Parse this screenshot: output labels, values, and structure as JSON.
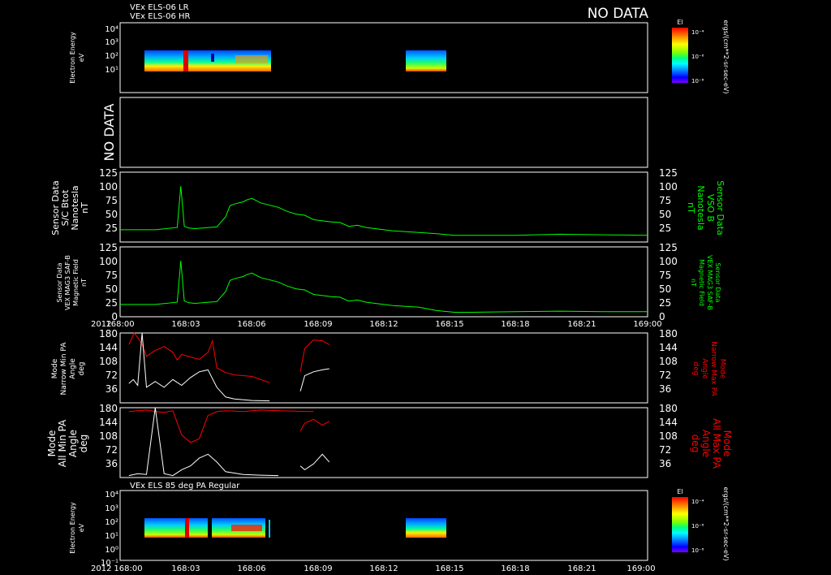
{
  "header": {
    "line1": "VEx ELS-06 LR",
    "line2": "VEx ELS-06 HR",
    "no_data": "NO DATA"
  },
  "time_axis": {
    "year": "2012",
    "ticks": [
      "168:00",
      "168:03",
      "168:06",
      "168:09",
      "168:12",
      "168:15",
      "168:18",
      "168:21",
      "169:00"
    ]
  },
  "colorbar": {
    "label": "El",
    "unit": "ergs/(cm**2-sr-sec-eV)",
    "top_tick": "10⁻⁴",
    "mid_tick": "10⁻⁶",
    "bottom_tick": "10⁻⁸",
    "colors": [
      "#ff0000",
      "#ff8000",
      "#ffff00",
      "#80ff00",
      "#00ff80",
      "#00ffff",
      "#0080ff",
      "#0000ff",
      "#8000ff"
    ]
  },
  "panels": {
    "els_spectrogram": {
      "ylabel": "Electron Energy",
      "yunit": "eV",
      "yticks": [
        "10⁴",
        "10³",
        "10²",
        "10¹"
      ]
    },
    "no_data_panel": {
      "text": "NO DATA"
    },
    "sc_btot": {
      "ylabel_left": [
        "Sensor Data",
        "S/C Btot",
        "Nanotesla",
        "nT"
      ],
      "ylabel_right": [
        "Sensor Data",
        "VSO B",
        "Nanotesla",
        "nT"
      ],
      "yticks": [
        "125",
        "100",
        "75",
        "50",
        "25"
      ]
    },
    "mag_field": {
      "ylabel_left": [
        "Sensor Data",
        "VEX MAG3 SAF-B",
        "Magnetic Field",
        "nT"
      ],
      "ylabel_right": [
        "Sensor Data",
        "VEX MAG3 SAF-B",
        "Magnetic Field",
        "nT"
      ],
      "yticks": [
        "125",
        "100",
        "75",
        "50",
        "25",
        "0"
      ]
    },
    "narrow_pa": {
      "ylabel_left": [
        "Mode",
        "Narrow Min PA",
        "Angle",
        "deg"
      ],
      "ylabel_right": [
        "Mode",
        "Narrow Max PA",
        "Angle",
        "deg"
      ],
      "yticks": [
        "180",
        "144",
        "108",
        "72",
        "36"
      ]
    },
    "all_pa": {
      "ylabel_left": [
        "Mode",
        "All Min PA",
        "Angle",
        "deg"
      ],
      "ylabel_right": [
        "Mode",
        "All Max PA",
        "Angle",
        "deg"
      ],
      "yticks": [
        "180",
        "144",
        "108",
        "72",
        "36"
      ]
    },
    "pa85": {
      "title": "VEx ELS 85 deg PA Regular",
      "ylabel": "Electron Energy",
      "yunit": "eV",
      "yticks": [
        "10⁴",
        "10³",
        "10²",
        "10¹",
        "10⁰",
        "10⁻¹"
      ]
    }
  },
  "chart_data": [
    {
      "type": "heatmap",
      "name": "ELS-06 spectrogram",
      "x_range_min": [
        0,
        60
      ],
      "ylabel": "Electron Energy (eV)",
      "y_log_range": [
        1,
        10000
      ],
      "data_intervals_min": [
        [
          0.9,
          9.5
        ],
        [
          20.5,
          23.5
        ]
      ],
      "peak_bands_min": [
        [
          2.7,
          3.0
        ]
      ]
    },
    {
      "type": "line",
      "name": "S/C Btot",
      "ylim": [
        0,
        125
      ],
      "color": "#00ff00",
      "x_min": [
        0,
        4,
        6.5,
        6.9,
        7.3,
        7.8,
        8.5,
        11,
        12,
        12.5,
        13,
        14,
        14.5,
        15,
        16,
        18,
        19,
        20,
        21,
        22,
        23,
        24,
        25,
        26,
        27,
        28,
        29,
        30,
        31,
        32,
        33,
        34,
        36,
        38,
        40,
        45,
        50,
        55,
        60
      ],
      "y": [
        22,
        22,
        26,
        100,
        28,
        25,
        24,
        27,
        45,
        65,
        68,
        72,
        76,
        78,
        70,
        62,
        55,
        50,
        48,
        40,
        38,
        36,
        35,
        28,
        30,
        26,
        24,
        22,
        20,
        19,
        18,
        17,
        15,
        12,
        12,
        12,
        14,
        13,
        12
      ]
    },
    {
      "type": "line",
      "name": "Magnetic Field",
      "ylim": [
        0,
        125
      ],
      "color": "#00ff00",
      "x_min": [
        0,
        4,
        6.5,
        6.9,
        7.3,
        7.8,
        8.5,
        11,
        12,
        12.5,
        13,
        14,
        14.5,
        15,
        16,
        18,
        19,
        20,
        21,
        22,
        23,
        24,
        25,
        26,
        27,
        28,
        29,
        30,
        31,
        32,
        33,
        34,
        36,
        38,
        40,
        45,
        50,
        55,
        60
      ],
      "y": [
        22,
        22,
        26,
        100,
        28,
        25,
        24,
        27,
        45,
        65,
        68,
        72,
        76,
        78,
        70,
        62,
        55,
        50,
        48,
        40,
        38,
        36,
        35,
        28,
        30,
        26,
        24,
        22,
        20,
        19,
        18,
        17,
        11,
        8,
        8,
        9,
        10,
        9,
        9
      ]
    },
    {
      "type": "line",
      "name": "Narrow PA",
      "ylim": [
        0,
        180
      ],
      "series": [
        {
          "color": "#ff0000",
          "segments": [
            {
              "x": [
                1,
                1.3,
                1.6,
                2,
                2.5,
                3,
                4,
                5,
                6,
                6.5,
                7,
                8,
                9,
                10,
                10.5,
                11,
                12,
                13,
                15,
                17
              ],
              "y": [
                150,
                165,
                180,
                168,
                150,
                120,
                135,
                145,
                130,
                110,
                125,
                118,
                112,
                130,
                160,
                90,
                78,
                72,
                68,
                52
              ]
            },
            {
              "x": [
                20.5,
                21,
                22,
                23,
                23.8
              ],
              "y": [
                80,
                140,
                162,
                160,
                150
              ]
            }
          ]
        },
        {
          "color": "#ffffff",
          "segments": [
            {
              "x": [
                1,
                1.5,
                2,
                2.5,
                3,
                4,
                5,
                6,
                7,
                8,
                9,
                10,
                11,
                12,
                13,
                15,
                17
              ],
              "y": [
                50,
                60,
                45,
                180,
                40,
                55,
                40,
                60,
                45,
                65,
                80,
                85,
                40,
                15,
                10,
                6,
                5
              ]
            },
            {
              "x": [
                20.5,
                21,
                22,
                23,
                23.8
              ],
              "y": [
                30,
                70,
                80,
                85,
                88
              ]
            }
          ]
        }
      ]
    },
    {
      "type": "line",
      "name": "All PA",
      "ylim": [
        0,
        180
      ],
      "series": [
        {
          "color": "#ff0000",
          "segments": [
            {
              "x": [
                1,
                2,
                3,
                4,
                5,
                6,
                7,
                8,
                9,
                10,
                11,
                12,
                14,
                16,
                18,
                22
              ],
              "y": [
                170,
                172,
                174,
                170,
                168,
                172,
                110,
                90,
                100,
                160,
                170,
                172,
                170,
                174,
                172,
                170
              ]
            },
            {
              "x": [
                20.5,
                21,
                22,
                23,
                23.8
              ],
              "y": [
                120,
                140,
                150,
                135,
                145
              ]
            }
          ]
        },
        {
          "color": "#ffffff",
          "segments": [
            {
              "x": [
                1,
                2,
                3,
                4,
                5,
                6,
                7,
                8,
                9,
                10,
                11,
                12,
                14,
                16,
                18
              ],
              "y": [
                5,
                10,
                8,
                180,
                10,
                5,
                20,
                30,
                50,
                60,
                40,
                15,
                8,
                6,
                5
              ]
            },
            {
              "x": [
                20.5,
                21,
                22,
                23,
                23.8
              ],
              "y": [
                30,
                20,
                35,
                60,
                40
              ]
            }
          ]
        }
      ]
    },
    {
      "type": "heatmap",
      "name": "ELS 85 deg PA Regular",
      "x_range_min": [
        0,
        60
      ],
      "y_log_range": [
        0.1,
        10000
      ],
      "data_intervals_min": [
        [
          0.9,
          5.5
        ],
        [
          6.0,
          9.8
        ],
        [
          20.5,
          23.5
        ]
      ],
      "peak_bands_min": [
        [
          3.0,
          3.3
        ]
      ]
    }
  ]
}
